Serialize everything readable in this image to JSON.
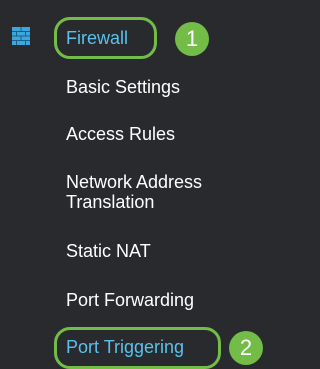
{
  "sidebar": {
    "section_icon": "firewall-brick-icon",
    "section_label": "Firewall",
    "items": [
      {
        "label": "Basic Settings"
      },
      {
        "label": "Access Rules"
      },
      {
        "label": "Network Address Translation"
      },
      {
        "label": "Static NAT"
      },
      {
        "label": "Port Forwarding"
      },
      {
        "label": "Port Triggering"
      }
    ]
  },
  "callouts": [
    {
      "number": "1"
    },
    {
      "number": "2"
    }
  ],
  "colors": {
    "background": "#282a2e",
    "text": "#ffffff",
    "active_text": "#5bc1ec",
    "highlight": "#73bc48",
    "icon": "#3aa7de"
  }
}
